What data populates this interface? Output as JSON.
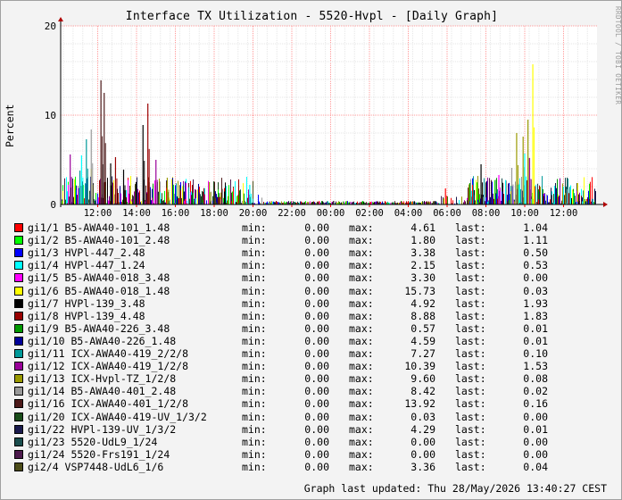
{
  "title": "Interface TX Utilization - 5520-Hvpl - [Daily Graph]",
  "watermark": "RRDTOOL / TOBI OETIKER",
  "chart_data": {
    "type": "line",
    "ylabel": "Percent",
    "ylim": [
      0,
      20
    ],
    "yticks": [
      "0",
      "10",
      "20"
    ],
    "xticks": [
      "12:00",
      "14:00",
      "16:00",
      "18:00",
      "20:00",
      "22:00",
      "00:00",
      "02:00",
      "04:00",
      "06:00",
      "08:00",
      "10:00",
      "12:00"
    ],
    "grid": true,
    "legend_placement": "bottom",
    "spikes": [
      {
        "time": "14:35",
        "value": 11.3,
        "series": 7
      },
      {
        "time": "14:20",
        "value": 8.9,
        "series": 6
      },
      {
        "time": "11:10",
        "value": 5.5,
        "series": 3
      },
      {
        "time": "11:40",
        "value": 4.0,
        "series": 5
      },
      {
        "time": "12:15",
        "value": 4.5,
        "series": 6
      },
      {
        "time": "13:20",
        "value": 3.9,
        "series": 6
      },
      {
        "time": "15:00",
        "value": 5.0,
        "series": 11
      },
      {
        "time": "15:35",
        "value": 3.0,
        "series": 12
      },
      {
        "time": "17:45",
        "value": 2.5,
        "series": 12
      },
      {
        "time": "19:50",
        "value": 2.2,
        "series": 3
      },
      {
        "time": "05:55",
        "value": 1.8,
        "series": 0
      },
      {
        "time": "07:45",
        "value": 4.5,
        "series": 6
      },
      {
        "time": "08:40",
        "value": 3.3,
        "series": 4
      },
      {
        "time": "09:20",
        "value": 4.1,
        "series": 13
      },
      {
        "time": "09:35",
        "value": 8.0,
        "series": 12
      },
      {
        "time": "09:55",
        "value": 7.6,
        "series": 12
      },
      {
        "time": "10:00",
        "value": 5.7,
        "series": 3
      },
      {
        "time": "10:10",
        "value": 9.5,
        "series": 12
      },
      {
        "time": "10:15",
        "value": 5.2,
        "series": 11
      },
      {
        "time": "10:25",
        "value": 15.7,
        "series": 5
      },
      {
        "time": "10:35",
        "value": 5.6,
        "series": 11
      },
      {
        "time": "11:05",
        "value": 3.8,
        "series": 10
      },
      {
        "time": "11:25",
        "value": 7.3,
        "series": 10
      },
      {
        "time": "11:40",
        "value": 8.4,
        "series": 13
      },
      {
        "time": "12:10",
        "value": 13.9,
        "series": 14
      },
      {
        "time": "12:20",
        "value": 12.5,
        "series": 14
      },
      {
        "time": "12:40",
        "value": 4.6,
        "series": 6
      },
      {
        "time": "12:55",
        "value": 5.3,
        "series": 7
      }
    ],
    "series": [
      {
        "name": "gi1/1 B5-AWA40-101_1.48",
        "color": "#ff0000",
        "min": "0.00",
        "max": "4.61",
        "last": "1.04"
      },
      {
        "name": "gi1/2 B5-AWA40-101_2.48",
        "color": "#00ff00",
        "min": "0.00",
        "max": "1.80",
        "last": "1.11"
      },
      {
        "name": "gi1/3 HVPl-447_2.48",
        "color": "#0000ff",
        "min": "0.00",
        "max": "3.38",
        "last": "0.50"
      },
      {
        "name": "gi1/4 HVPl-447_1.24",
        "color": "#00ffff",
        "min": "0.00",
        "max": "2.15",
        "last": "0.53"
      },
      {
        "name": "gi1/5 B5-AWA40-018_3.48",
        "color": "#ff00ff",
        "min": "0.00",
        "max": "3.30",
        "last": "0.00"
      },
      {
        "name": "gi1/6 B5-AWA40-018_1.48",
        "color": "#ffff00",
        "min": "0.00",
        "max": "15.73",
        "last": "0.03"
      },
      {
        "name": "gi1/7 HVPl-139_3.48",
        "color": "#000000",
        "min": "0.00",
        "max": "4.92",
        "last": "1.93"
      },
      {
        "name": "gi1/8 HVPl-139_4.48",
        "color": "#990000",
        "min": "0.00",
        "max": "8.88",
        "last": "1.83"
      },
      {
        "name": "gi1/9 B5-AWA40-226_3.48",
        "color": "#009900",
        "min": "0.00",
        "max": "0.57",
        "last": "0.01"
      },
      {
        "name": "gi1/10 B5-AWA40-226_1.48",
        "color": "#000099",
        "min": "0.00",
        "max": "4.59",
        "last": "0.01"
      },
      {
        "name": "gi1/11 ICX-AWA40-419_2/2/8",
        "color": "#009999",
        "min": "0.00",
        "max": "7.27",
        "last": "0.10"
      },
      {
        "name": "gi1/12 ICX-AWA40-419_1/2/8",
        "color": "#990099",
        "min": "0.00",
        "max": "10.39",
        "last": "1.53"
      },
      {
        "name": "gi1/13 ICX-Hvpl-TZ_1/2/8",
        "color": "#999900",
        "min": "0.00",
        "max": "9.60",
        "last": "0.08"
      },
      {
        "name": "gi1/14 B5-AWA40-401_2.48",
        "color": "#999999",
        "min": "0.00",
        "max": "8.42",
        "last": "0.02"
      },
      {
        "name": "gi1/16 ICX-AWA40-401_1/2/8",
        "color": "#4d1a1a",
        "min": "0.00",
        "max": "13.92",
        "last": "0.16"
      },
      {
        "name": "gi1/20 ICX-AWA40-419-UV_1/3/2",
        "color": "#1a4d1a",
        "min": "0.00",
        "max": "0.03",
        "last": "0.00"
      },
      {
        "name": "gi1/22 HVPl-139-UV_1/3/2",
        "color": "#1a1a4d",
        "min": "0.00",
        "max": "4.29",
        "last": "0.01"
      },
      {
        "name": "gi1/23 5520-UdL9_1/24",
        "color": "#1a4d4d",
        "min": "0.00",
        "max": "0.00",
        "last": "0.00"
      },
      {
        "name": "gi1/24 5520-Frs191_1/24",
        "color": "#4d1a4d",
        "min": "0.00",
        "max": "0.00",
        "last": "0.00"
      },
      {
        "name": "gi2/4 VSP7448-UdL6_1/6",
        "color": "#4d4d1a",
        "min": "0.00",
        "max": "3.36",
        "last": "0.04"
      }
    ]
  },
  "legend_labels": {
    "min": "min:",
    "max": "max:",
    "last": "last:"
  },
  "footer": "Graph last updated: Thu 28/May/2026 13:40:27 CEST"
}
